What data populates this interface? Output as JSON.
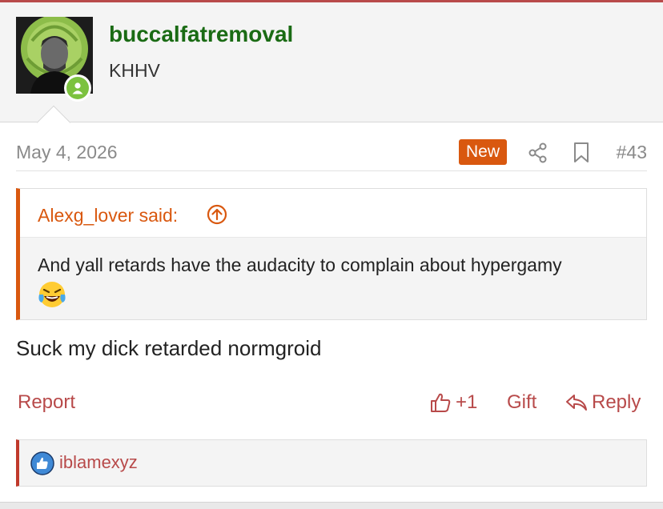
{
  "author": {
    "username": "buccalfatremoval",
    "user_title": "KHHV",
    "online": true
  },
  "post": {
    "date": "May 4, 2026",
    "new_badge": "New",
    "number": "#43",
    "body": "Suck my dick retarded normgroid"
  },
  "quote": {
    "attribution": "Alexg_lover said:",
    "text": "And yall retards have the audacity to complain about hypergamy"
  },
  "actions": {
    "report": "Report",
    "like_count": "+1",
    "gift": "Gift",
    "reply": "Reply"
  },
  "reactions": {
    "users": [
      "iblamexyz"
    ]
  },
  "colors": {
    "accent": "#b84a4a",
    "username": "#1a6b14",
    "new_badge": "#d9580f",
    "online": "#7cc23f"
  }
}
